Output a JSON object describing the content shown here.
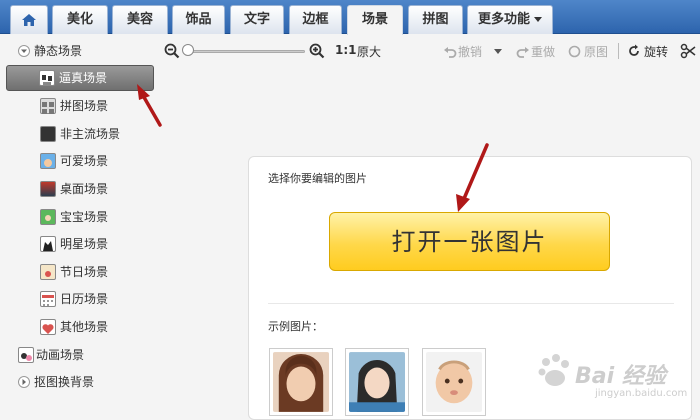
{
  "tabs": [
    {
      "label": "",
      "icon": "home-icon"
    },
    {
      "label": "美化"
    },
    {
      "label": "美容"
    },
    {
      "label": "饰品"
    },
    {
      "label": "文字"
    },
    {
      "label": "边框"
    },
    {
      "label": "场景",
      "active": true
    },
    {
      "label": "拼图"
    },
    {
      "label": "更多功能",
      "has_dropdown": true
    }
  ],
  "sidebar": {
    "static_group_label": "静态场景",
    "items": [
      {
        "label": "逼真场景",
        "selected": true
      },
      {
        "label": "拼图场景"
      },
      {
        "label": "非主流场景"
      },
      {
        "label": "可爱场景"
      },
      {
        "label": "桌面场景"
      },
      {
        "label": "宝宝场景"
      },
      {
        "label": "明星场景"
      },
      {
        "label": "节日场景"
      },
      {
        "label": "日历场景"
      },
      {
        "label": "其他场景"
      }
    ],
    "animated_group_label": "动画场景",
    "cutout_group_label": "抠图换背景"
  },
  "toolbar": {
    "ratio_label": "1:1",
    "original_size_label": "原大",
    "undo_label": "撤销",
    "redo_label": "重做",
    "original_image_label": "原图",
    "rotate_label": "旋转",
    "zoom_level": 0
  },
  "main": {
    "prompt": "选择你要编辑的图片",
    "open_button": "打开一张图片",
    "samples_label": "示例图片："
  },
  "watermark": {
    "text": "Bai 经验",
    "sub": "jingyan.baidu.com"
  },
  "colors": {
    "tabbar": "#3b72b9",
    "open_button": "#ffd84a",
    "arrow": "#b01818"
  }
}
